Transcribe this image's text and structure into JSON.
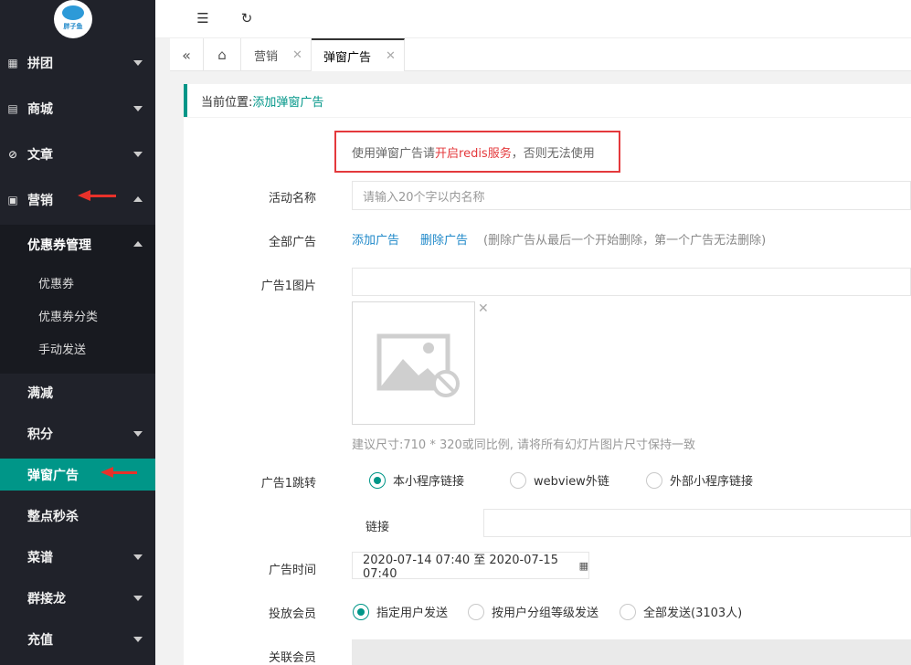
{
  "logo": {
    "text": "胖子鱼"
  },
  "sidebar": {
    "items": [
      {
        "label": "拼团",
        "icon": "grid-icon"
      },
      {
        "label": "商城",
        "icon": "store-icon"
      },
      {
        "label": "文章",
        "icon": "compass-icon"
      },
      {
        "label": "营销",
        "icon": "gift-icon"
      }
    ],
    "submenu_title": "优惠券管理",
    "submenu_items": [
      "优惠券",
      "优惠券分类",
      "手动发送"
    ],
    "more_items": [
      "满减",
      "积分",
      "弹窗广告",
      "整点秒杀",
      "菜谱",
      "群接龙",
      "充值"
    ],
    "active_item": "弹窗广告"
  },
  "tabs": [
    {
      "label": "营销"
    },
    {
      "label": "弹窗广告",
      "active": true
    }
  ],
  "breadcrumb": {
    "prefix": "当前位置:",
    "current": "添加弹窗广告"
  },
  "notice": {
    "before": "使用弹窗广告请",
    "highlight": "开启redis服务",
    "after": "，否则无法使用"
  },
  "form": {
    "name_label": "活动名称",
    "name_placeholder": "请输入20个字以内名称",
    "all_ads_label": "全部广告",
    "add_ad": "添加广告",
    "delete_ad": "删除广告",
    "delete_hint": "(删除广告从最后一个开始删除，第一个广告无法删除)",
    "ad1_image_label": "广告1图片",
    "image_size_hint": "建议尺寸:710 * 320或同比例, 请将所有幻灯片图片尺寸保持一致",
    "ad1_jump_label": "广告1跳转",
    "jump_options": [
      "本小程序链接",
      "webview外链",
      "外部小程序链接"
    ],
    "jump_selected": 0,
    "link_label": "链接",
    "time_label": "广告时间",
    "time_value": "2020-07-14 07:40 至 2020-07-15 07:40",
    "audience_label": "投放会员",
    "audience_options": [
      "指定用户发送",
      "按用户分组等级发送",
      "全部发送(3103人)"
    ],
    "audience_selected": 0,
    "related_label": "关联会员"
  },
  "colors": {
    "accent": "#009688",
    "sidebar": "#20222a",
    "alert": "#e4393c",
    "link": "#1e88c9"
  }
}
